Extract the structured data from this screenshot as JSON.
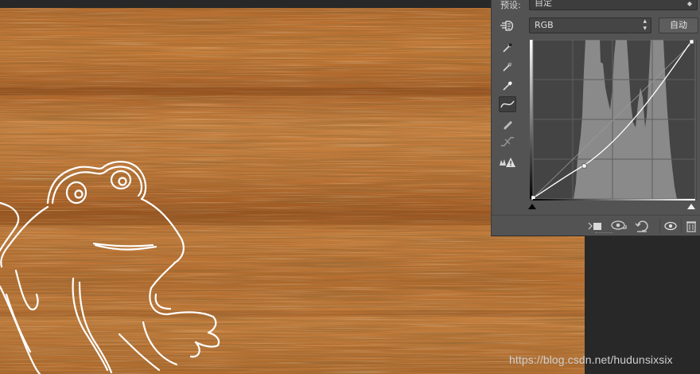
{
  "panel": {
    "preset_label": "预设:",
    "preset_value": "自定",
    "channel_value": "RGB",
    "auto_label": "自动"
  },
  "tools": [
    {
      "name": "eyedropper-black-icon"
    },
    {
      "name": "eyedropper-gray-icon"
    },
    {
      "name": "eyedropper-white-icon"
    },
    {
      "name": "curve-edit-icon",
      "active": true
    },
    {
      "name": "pencil-icon"
    },
    {
      "name": "smooth-icon"
    },
    {
      "name": "clipping-warning-icon"
    }
  ],
  "bottom_toolbar": [
    "clip-to-layer-icon",
    "view-previous-icon",
    "reset-icon",
    "visibility-eye-icon",
    "trash-icon"
  ],
  "colors": {
    "panel_bg": "#535353",
    "graph_bg": "#444444",
    "histogram": "#8c8c8c",
    "wood_base": "#b8702f",
    "sketch_line": "#ffffff"
  },
  "watermark": "https://blog.csdn.net/hudunsixsix"
}
